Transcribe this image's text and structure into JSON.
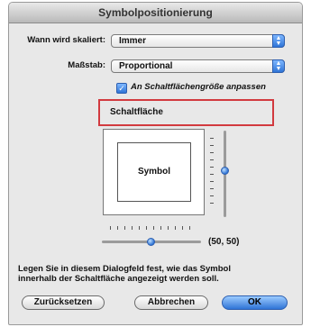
{
  "dialog": {
    "title": "Symbolpositionierung"
  },
  "scaling": {
    "label": "Wann wird skaliert:",
    "value": "Immer"
  },
  "scale": {
    "label": "Maßstab:",
    "value": "Proportional"
  },
  "fit_checkbox": {
    "label": "An Schaltflächengröße anpassen",
    "checked": true
  },
  "button_preview": {
    "label": "Schaltfläche"
  },
  "preview": {
    "symbol_label": "Symbol",
    "position_readout": "(50, 50)",
    "horizontal_position_percent": 50,
    "vertical_position_percent": 50
  },
  "description": {
    "line1": "Legen Sie in diesem Dialogfeld fest, wie das Symbol",
    "line2": "innerhalb der Schaltfläche angezeigt werden soll."
  },
  "buttons": {
    "reset": "Zurücksetzen",
    "cancel": "Abbrechen",
    "ok": "OK"
  },
  "colors": {
    "accent": "#2f74d6",
    "highlight": "#d23a3f"
  }
}
